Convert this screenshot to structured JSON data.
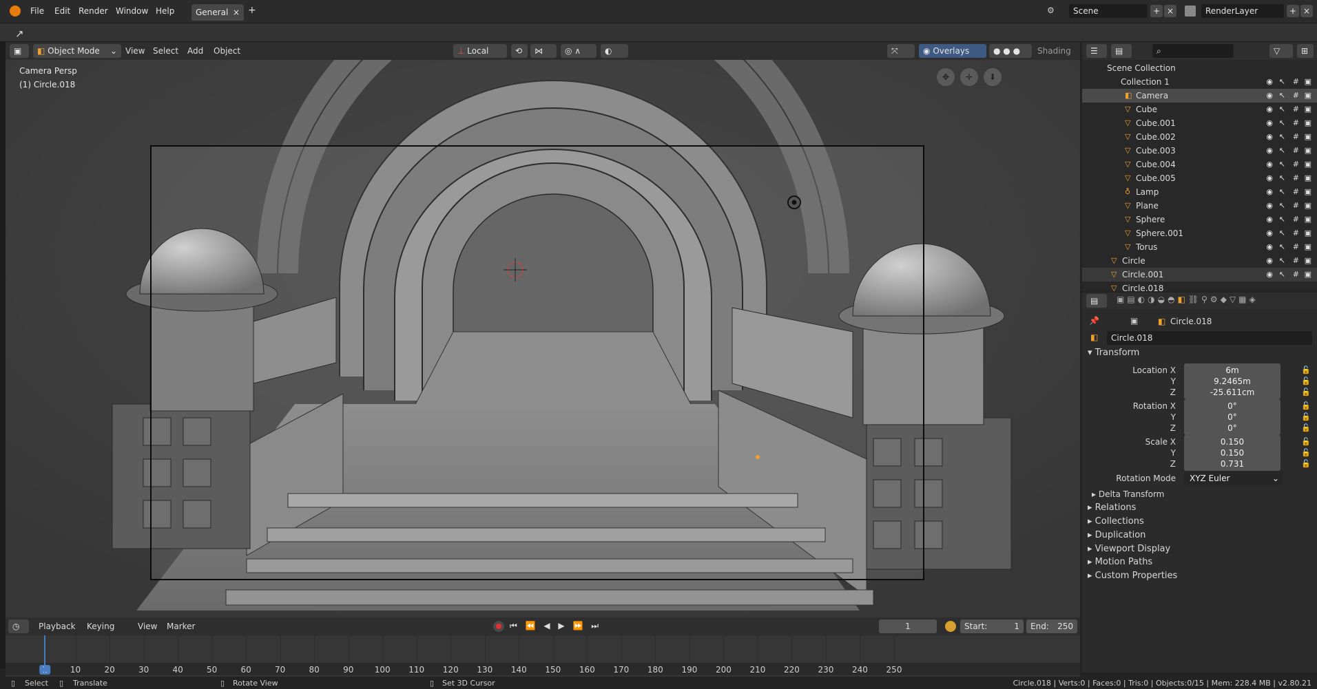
{
  "topbar": {
    "menus": [
      "File",
      "Edit",
      "Render",
      "Window",
      "Help"
    ],
    "tab_label": "General",
    "tab_close": "×",
    "add_tab": "+",
    "scene_label": "Scene",
    "render_layer_label": "RenderLayer"
  },
  "viewport_header": {
    "mode": "Object Mode",
    "menus": [
      "View",
      "Select",
      "Add",
      "Object"
    ],
    "orientation": "Local",
    "overlays": "Overlays",
    "shading": "Shading"
  },
  "viewport": {
    "view_name": "Camera Persp",
    "object_name": "(1) Circle.018"
  },
  "outliner": {
    "search_placeholder": "",
    "rows": [
      {
        "label": "Scene Collection"
      },
      {
        "label": "Collection 1"
      },
      {
        "label": "Camera"
      },
      {
        "label": "Cube"
      },
      {
        "label": "Cube.001"
      },
      {
        "label": "Cube.002"
      },
      {
        "label": "Cube.003"
      },
      {
        "label": "Cube.004"
      },
      {
        "label": "Cube.005"
      },
      {
        "label": "Lamp"
      },
      {
        "label": "Plane"
      },
      {
        "label": "Sphere"
      },
      {
        "label": "Sphere.001"
      },
      {
        "label": "Torus"
      },
      {
        "label": "Circle"
      },
      {
        "label": "Circle.001"
      },
      {
        "label": "Circle.018"
      }
    ]
  },
  "properties": {
    "object_breadcrumb": "Circle.018",
    "object_name": "Circle.018",
    "transform_title": "Transform",
    "location_label": "Location X",
    "location": [
      "6m",
      "9.2465m",
      "-25.611cm"
    ],
    "rotation_label": "Rotation X",
    "rotation": [
      "0°",
      "0°",
      "0°"
    ],
    "scale_label": "Scale X",
    "scale": [
      "0.150",
      "0.150",
      "0.731"
    ],
    "axis_y": "Y",
    "axis_z": "Z",
    "rotation_mode_label": "Rotation Mode",
    "rotation_mode": "XYZ Euler",
    "panels": [
      "Delta Transform",
      "Relations",
      "Collections",
      "Duplication",
      "Viewport Display",
      "Motion Paths",
      "Custom Properties"
    ]
  },
  "timeline": {
    "menus": [
      "Playback",
      "Keying",
      "View",
      "Marker"
    ],
    "current_frame": "1",
    "start_label": "Start:",
    "start": "1",
    "end_label": "End:",
    "end": "250",
    "ticks": [
      "1",
      "10",
      "20",
      "30",
      "40",
      "50",
      "60",
      "70",
      "80",
      "90",
      "100",
      "110",
      "120",
      "130",
      "140",
      "150",
      "160",
      "170",
      "180",
      "190",
      "200",
      "210",
      "220",
      "230",
      "240",
      "250"
    ]
  },
  "statusbar": {
    "select": "Select",
    "translate": "Translate",
    "rotate_view": "Rotate View",
    "set_cursor": "Set 3D Cursor",
    "stats": "Circle.018 | Verts:0 | Faces:0 | Tris:0 | Objects:0/15 | Mem: 228.4 MB | v2.80.21"
  }
}
